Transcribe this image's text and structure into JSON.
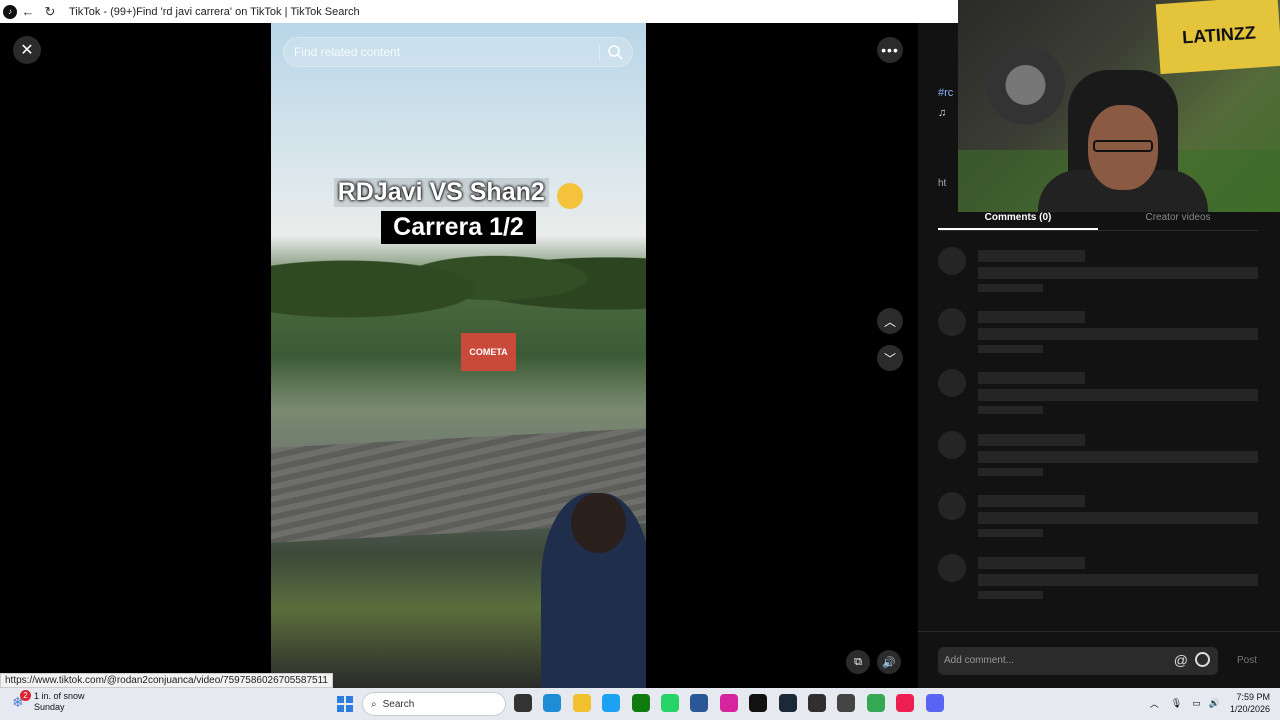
{
  "browser": {
    "tab_title": "TikTok - (99+)Find 'rd javi carrera' on TikTok | TikTok Search",
    "back_icon": "←",
    "reload_icon": "↻"
  },
  "player": {
    "close_icon": "✕",
    "search_placeholder": "Find related content",
    "caption_line1": "RDJavi VS Shan2",
    "caption_line2": "Carrera 1/2",
    "billboard_text": "COMETA",
    "more_icon": "•••",
    "up_icon": "︿",
    "down_icon": "﹀",
    "pip_icon": "⧉",
    "volume_icon": "🔊",
    "link_preview": "https://www.tiktok.com/@rodan2conjuanca/video/7597586026705587511"
  },
  "side_panel": {
    "peek_hashtag": "#rc",
    "peek_music": "♫",
    "peek_link": "ht",
    "tabs": [
      {
        "label": "Comments (0)",
        "active": true
      },
      {
        "label": "Creator videos",
        "active": false
      }
    ],
    "comment_placeholder": "Add comment...",
    "at_icon": "@",
    "post_label": "Post"
  },
  "webcam": {
    "graffiti_text": "LATINZZ"
  },
  "taskbar": {
    "weather_badge": "2",
    "weather_text": "1 in. of snow",
    "weather_day": "Sunday",
    "search_label": "Search",
    "time": "7:59 PM",
    "date": "1/20/2026",
    "apps": [
      {
        "name": "task-view-icon",
        "color": "#333333"
      },
      {
        "name": "edge-icon",
        "color": "#1f8dd6"
      },
      {
        "name": "file-explorer-icon",
        "color": "#f2c12e"
      },
      {
        "name": "twitter-icon",
        "color": "#1da1f2"
      },
      {
        "name": "xbox-icon",
        "color": "#107c10"
      },
      {
        "name": "whatsapp-icon",
        "color": "#25d366"
      },
      {
        "name": "store-icon",
        "color": "#2b5797"
      },
      {
        "name": "instagram-icon",
        "color": "#d6249f"
      },
      {
        "name": "tiktok-icon",
        "color": "#111111"
      },
      {
        "name": "steam-icon",
        "color": "#1b2838"
      },
      {
        "name": "obs-icon",
        "color": "#302e31"
      },
      {
        "name": "app-icon",
        "color": "#444444"
      },
      {
        "name": "chrome-icon",
        "color": "#34a853"
      },
      {
        "name": "tiktok-red-icon",
        "color": "#ee1d52"
      },
      {
        "name": "discord-icon",
        "color": "#5865f2"
      }
    ]
  }
}
